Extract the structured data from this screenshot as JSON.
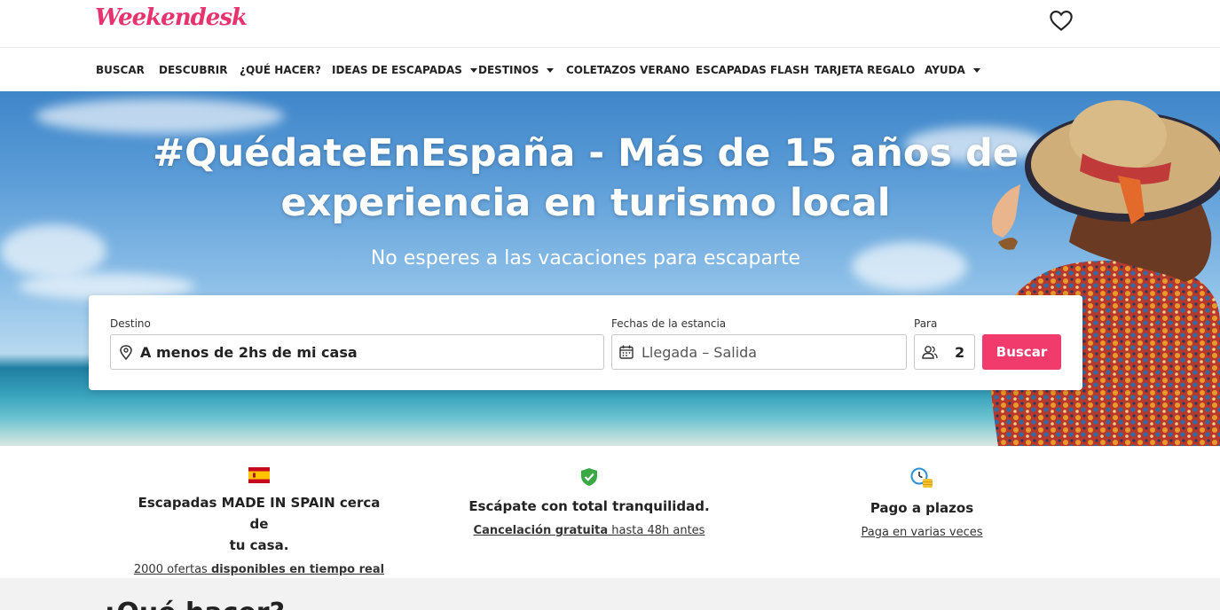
{
  "header": {
    "logo_text": "Weekendesk",
    "brand_color": "#e8336e"
  },
  "nav": {
    "items": [
      {
        "label": "BUSCAR",
        "dropdown": false
      },
      {
        "label": "DESCUBRIR",
        "dropdown": false
      },
      {
        "label": "¿QUÉ HACER?",
        "dropdown": false
      },
      {
        "label": "IDEAS DE ESCAPADAS",
        "dropdown": true
      },
      {
        "label": "DESTINOS",
        "dropdown": true
      },
      {
        "label": "COLETAZOS VERANO",
        "dropdown": false
      },
      {
        "label": "ESCAPADAS FLASH",
        "dropdown": false
      },
      {
        "label": "TARJETA REGALO",
        "dropdown": false
      },
      {
        "label": "AYUDA",
        "dropdown": true
      }
    ]
  },
  "hero": {
    "title_line1": "#QuédateEnEspaña - Más de 15 años de",
    "title_line2": "experiencia en turismo local",
    "subtitle": "No esperes a las vacaciones para escaparte"
  },
  "search": {
    "destino_label": "Destino",
    "destino_value": "A menos de 2hs de mi casa",
    "fechas_label": "Fechas de la estancia",
    "fechas_placeholder": "Llegada – Salida",
    "para_label": "Para",
    "guests_value": "2",
    "button_label": "Buscar",
    "button_color": "#f23b6d"
  },
  "features": [
    {
      "icon": "spain-flag-icon",
      "title_line1": "Escapadas MADE IN SPAIN cerca de",
      "title_line2": "tu casa.",
      "link_part1": "2000 ofertas ",
      "link_part2": "disponibles en tiempo real"
    },
    {
      "icon": "shield-check-icon",
      "title_line1": "Escápate con total tranquilidad.",
      "link_part1": "Cancelación gratuita",
      "link_part2": " hasta 48h antes"
    },
    {
      "icon": "clock-coins-icon",
      "title_line1": "Pago a plazos",
      "link_part1": "Paga en varias veces"
    }
  ],
  "bottom": {
    "heading": "¿Qué hacer?"
  }
}
